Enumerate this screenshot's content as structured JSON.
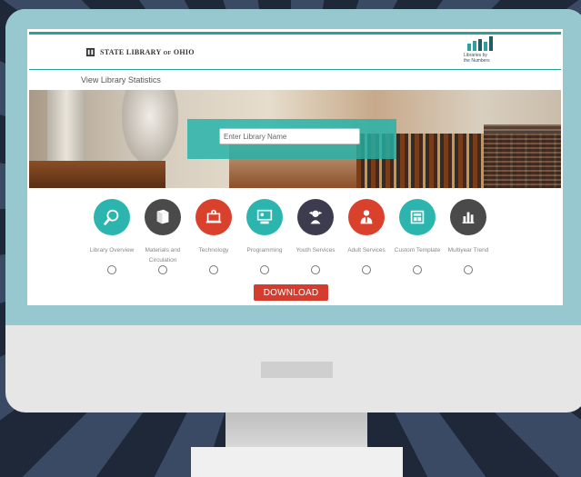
{
  "header": {
    "org_name": "STATE LIBRARY of OHIO",
    "org_name_main": "STATE LIBRARY",
    "org_name_of": "OF",
    "org_name_tail": "OHIO",
    "logo_line1": "Libraries by",
    "logo_line2": "the Numbers"
  },
  "page": {
    "subtitle": "View Library Statistics"
  },
  "search": {
    "placeholder": "Enter Library Name"
  },
  "reports": [
    {
      "label": "Library Overview",
      "icon": "magnifier-icon",
      "color": "#2bb5ae"
    },
    {
      "label": "Materials and Circulation",
      "icon": "books-icon",
      "color": "#4a4a4a"
    },
    {
      "label": "Technology",
      "icon": "laptop-gear-icon",
      "color": "#d9412d"
    },
    {
      "label": "Programming",
      "icon": "presentation-icon",
      "color": "#2bb5ae"
    },
    {
      "label": "Youth Services",
      "icon": "child-icon",
      "color": "#3c3c4e"
    },
    {
      "label": "Adult Services",
      "icon": "person-tie-icon",
      "color": "#d9412d"
    },
    {
      "label": "Custom Template",
      "icon": "template-icon",
      "color": "#2bb5ae"
    },
    {
      "label": "Multiyear Trend",
      "icon": "bar-chart-icon",
      "color": "#4a4a4a"
    }
  ],
  "actions": {
    "download_label": "DOWNLOAD"
  },
  "colors": {
    "teal": "#27a39a",
    "red": "#d43c2e",
    "bezel": "#98c8cf"
  }
}
